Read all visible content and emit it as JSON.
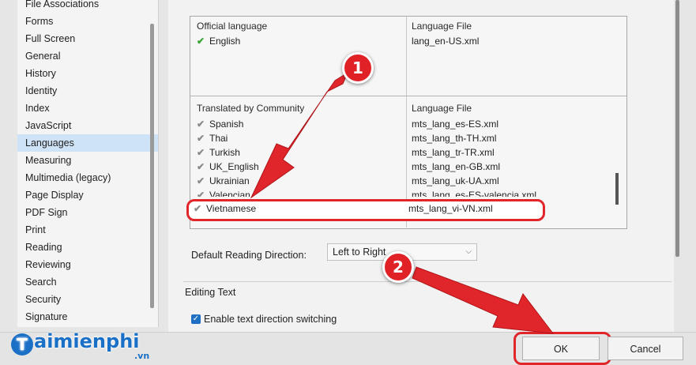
{
  "sidebar": {
    "items": [
      {
        "label": "File Associations"
      },
      {
        "label": "Forms"
      },
      {
        "label": "Full Screen"
      },
      {
        "label": "General"
      },
      {
        "label": "History"
      },
      {
        "label": "Identity"
      },
      {
        "label": "Index"
      },
      {
        "label": "JavaScript"
      },
      {
        "label": "Languages",
        "selected": true
      },
      {
        "label": "Measuring"
      },
      {
        "label": "Multimedia (legacy)"
      },
      {
        "label": "Page Display"
      },
      {
        "label": "PDF Sign"
      },
      {
        "label": "Print"
      },
      {
        "label": "Reading"
      },
      {
        "label": "Reviewing"
      },
      {
        "label": "Search"
      },
      {
        "label": "Security"
      },
      {
        "label": "Signature"
      }
    ]
  },
  "official": {
    "header_col1": "Official language",
    "header_col2": "Language File",
    "rows": [
      {
        "lang": "English",
        "file": "lang_en-US.xml"
      }
    ]
  },
  "community": {
    "header_col1": "Translated by Community",
    "header_col2": "Language File",
    "rows": [
      {
        "lang": "Spanish",
        "file": "mts_lang_es-ES.xml"
      },
      {
        "lang": "Thai",
        "file": "mts_lang_th-TH.xml"
      },
      {
        "lang": "Turkish",
        "file": "mts_lang_tr-TR.xml"
      },
      {
        "lang": "UK_English",
        "file": "mts_lang_en-GB.xml"
      },
      {
        "lang": "Ukrainian",
        "file": "mts_lang_uk-UA.xml"
      },
      {
        "lang": "Valencian",
        "file": "mts_lang_es-ES-valencia.xml"
      },
      {
        "lang": "Vietnamese",
        "file": "mts_lang_vi-VN.xml"
      }
    ]
  },
  "reading_direction": {
    "label": "Default Reading Direction:",
    "value": "Left to Right"
  },
  "editing": {
    "title": "Editing Text",
    "checkbox_label": "Enable text direction switching",
    "checked": true
  },
  "footer": {
    "ok_label": "OK",
    "cancel_label": "Cancel"
  },
  "annotations": {
    "badge1": "1",
    "badge2": "2",
    "highlight_color": "#e0262a"
  },
  "logo": {
    "mark": "T",
    "name": "aimienphi",
    "suffix": ".vn"
  },
  "icons": {
    "check": "check-icon",
    "dropdown": "chevron-down-icon"
  }
}
